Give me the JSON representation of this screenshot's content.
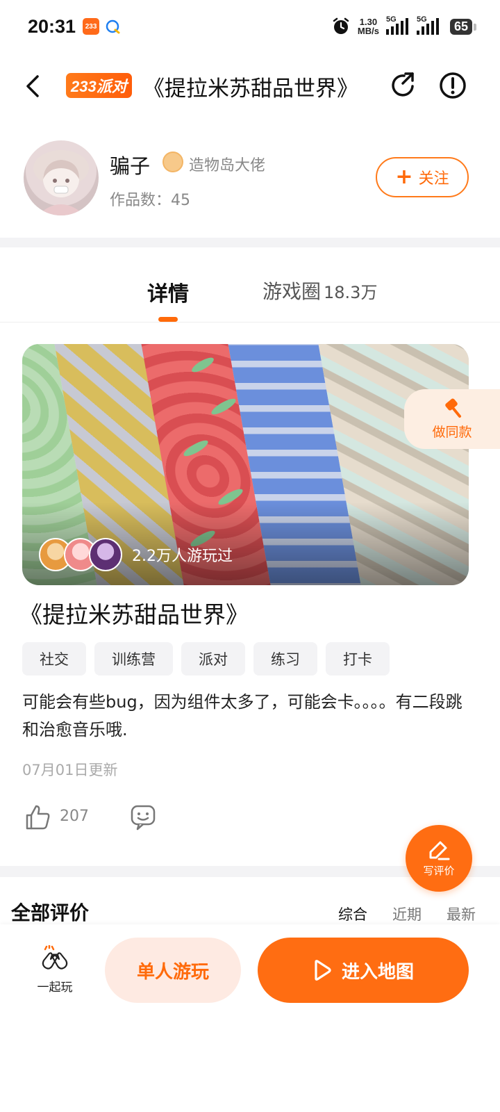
{
  "status_bar": {
    "time": "20:31",
    "app_badge": "233",
    "net_speed_value": "1.30",
    "net_speed_unit": "MB/s",
    "signal1_label": "5G",
    "signal2_label": "5G",
    "battery": "65"
  },
  "header": {
    "brand": "233派对",
    "title": "《提拉米苏甜品世界》"
  },
  "author": {
    "name": "骗子",
    "rank": "造物岛大佬",
    "works": "作品数：45",
    "follow_label": "关注"
  },
  "tabs": {
    "detail": "详情",
    "circle": "游戏圈",
    "circle_count": "18.3万"
  },
  "hero": {
    "played_text": "2.2万人游玩过",
    "make_same_label": "做同款"
  },
  "game": {
    "title": "《提拉米苏甜品世界》",
    "tags": [
      "社交",
      "训练营",
      "派对",
      "练习",
      "打卡"
    ],
    "description": "可能会有些bug，因为组件太多了，可能会卡。。。。有二段跳和治愈音乐哦.",
    "updated": "07月01日更新",
    "likes": "207"
  },
  "write_review_label": "写评价",
  "reviews": {
    "title": "全部评价",
    "sort_options": [
      "综合",
      "近期",
      "最新"
    ]
  },
  "bottom_bar": {
    "play_together": "一起玩",
    "solo": "单人游玩",
    "enter_map": "进入地图"
  },
  "colors": {
    "accent": "#ff6d12",
    "accent_soft": "#feeae2"
  }
}
